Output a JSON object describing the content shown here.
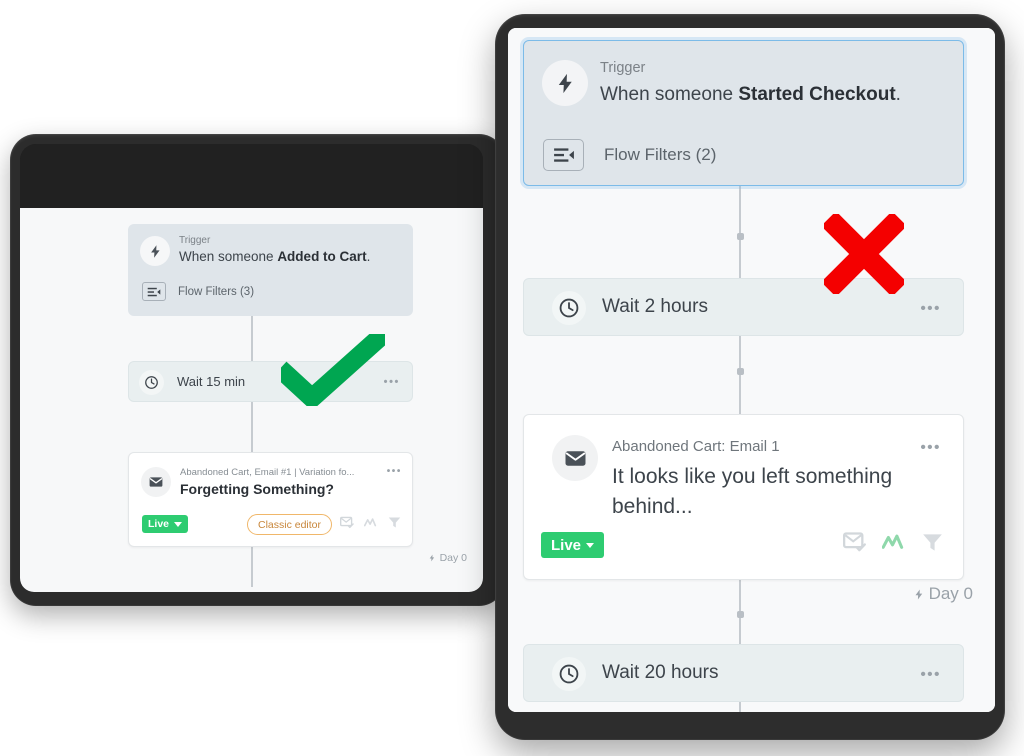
{
  "meta": {
    "scene": "Two tablets side by side showing a marketing automation flow builder; the left flow is marked with a green check mark and the right flow is marked with a red X."
  },
  "left_tablet": {
    "device_name": "tablet-left",
    "flow": {
      "trigger": {
        "eyebrow": "Trigger",
        "sentence_prefix": "When someone ",
        "sentence_bold": "Added to Cart",
        "sentence_suffix": ".",
        "filters_label": "Flow Filters (3)",
        "filters_icon": "flow-filters-icon",
        "avatar_icon": "bolt-icon"
      },
      "wait": {
        "label": "Wait 15 min",
        "avatar_icon": "clock-icon",
        "menu_icon": "ellipsis-icon"
      },
      "email": {
        "eyebrow": "Abandoned Cart, Email #1 | Variation fo...",
        "subject": "Forgetting Something?",
        "status_badge": "Live",
        "editor_chip": "Classic editor",
        "avatar_icon": "envelope-icon",
        "menu_icon": "ellipsis-icon",
        "icons": [
          "smart-sending-icon",
          "analytics-icon",
          "filter-icon"
        ]
      },
      "day_marker": "Day 0"
    }
  },
  "right_tablet": {
    "device_name": "tablet-right",
    "flow": {
      "trigger": {
        "eyebrow": "Trigger",
        "sentence_prefix": "When someone ",
        "sentence_bold": "Started Checkout",
        "sentence_suffix": ".",
        "filters_label": "Flow Filters (2)",
        "filters_icon": "flow-filters-icon",
        "avatar_icon": "bolt-icon",
        "selected": true
      },
      "wait_1": {
        "label": "Wait 2 hours",
        "avatar_icon": "clock-icon",
        "menu_icon": "ellipsis-icon"
      },
      "email": {
        "eyebrow": "Abandoned Cart: Email 1",
        "subject": "It looks like you left something behind...",
        "status_badge": "Live",
        "avatar_icon": "envelope-icon",
        "menu_icon": "ellipsis-icon",
        "icons": [
          "smart-sending-icon",
          "analytics-icon",
          "filter-icon"
        ]
      },
      "day_marker": "Day 0",
      "wait_2": {
        "label": "Wait 20 hours",
        "avatar_icon": "clock-icon",
        "menu_icon": "ellipsis-icon"
      }
    }
  },
  "annotations": {
    "check": {
      "name": "green-check-annotation",
      "color": "#00a651",
      "target": "left-flow"
    },
    "cross": {
      "name": "red-x-annotation",
      "color": "#f40000",
      "target": "right-flow"
    }
  },
  "colors": {
    "device_bezel": "#2c2c2c",
    "canvas": "#f8f9fa",
    "trigger_card": "#dfe5ea",
    "trigger_border_selected": "#7cbbe8",
    "wait_card": "#e9eff0",
    "email_card": "#ffffff",
    "live_green": "#2ecc71",
    "classic_editor_orange": "#f0b76a",
    "connector": "#c6cbd0",
    "text_primary": "#3d444b",
    "text_muted": "#7b8187"
  },
  "glyphs": {
    "ellipsis": "•••",
    "caret_down": "▼"
  }
}
